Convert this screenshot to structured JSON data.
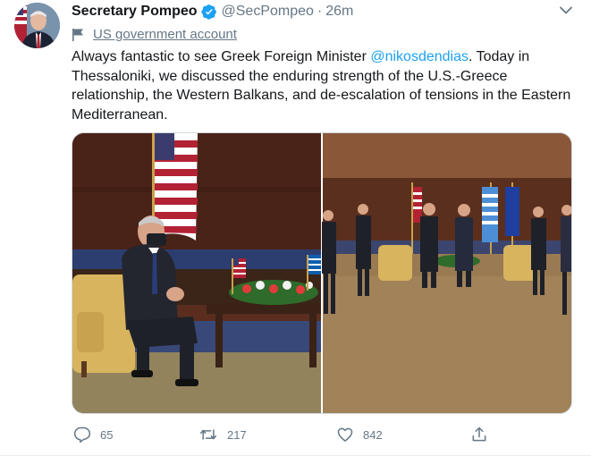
{
  "tweet": {
    "author_name": "Secretary Pompeo",
    "handle": "@SecPompeo",
    "separator": "·",
    "time": "26m",
    "account_label": "US government account",
    "text_before": "Always fantastic to see Greek Foreign Minister ",
    "mention": "@nikosdendias",
    "text_after": ". Today in Thessaloniki, we discussed the enduring strength of the U.S.-Greece relationship, the Western Balkans, and de-escalation of tensions in the Eastern Mediterranean."
  },
  "actions": {
    "reply_count": "65",
    "retweet_count": "217",
    "like_count": "842"
  },
  "icons": {
    "verified": "verified-badge-icon",
    "caret": "chevron-down-icon",
    "account_flag": "flag-icon",
    "reply": "reply-icon",
    "retweet": "retweet-icon",
    "like": "heart-icon",
    "share": "share-icon"
  },
  "colors": {
    "accent": "#1da1f2",
    "secondary_text": "#657786",
    "primary_text": "#14171a"
  }
}
